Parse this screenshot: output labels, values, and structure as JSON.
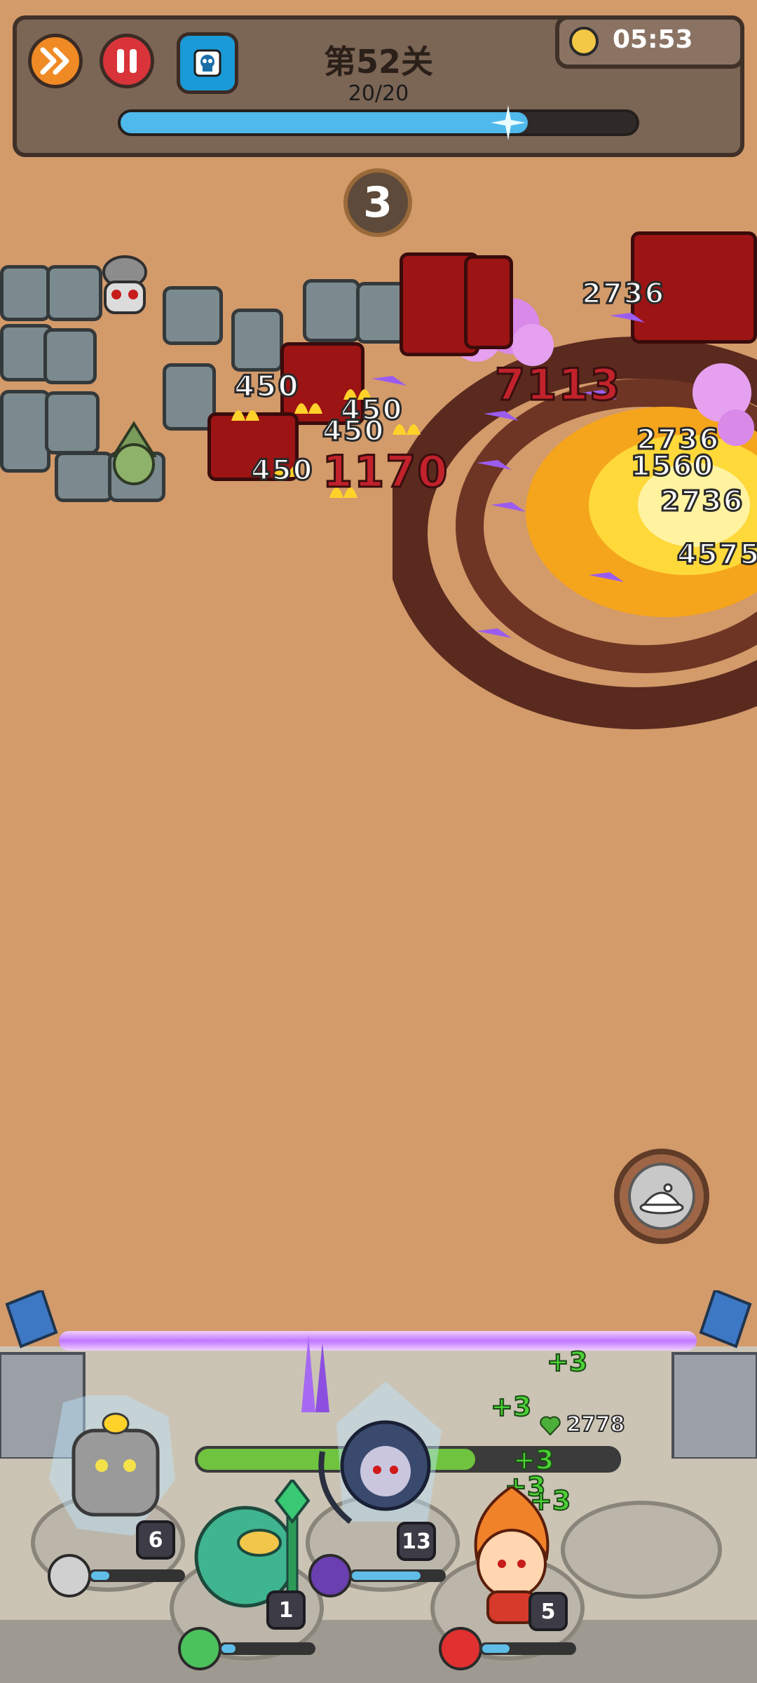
{
  "hud": {
    "level_title": "第52关",
    "wave_count": "20/20",
    "progress": 0.79,
    "timer": "05:53"
  },
  "countdown": "3",
  "damage_numbers": [
    "450",
    "450",
    "450",
    "450",
    "1170",
    "7113",
    "2736",
    "2736",
    "1560",
    "2736",
    "4575"
  ],
  "base": {
    "hp": "2778",
    "hp_fraction": 0.66,
    "heals": [
      "+3",
      "+3",
      "+3",
      "+3",
      "+3"
    ]
  },
  "heroes": [
    {
      "level": "6",
      "mana": 0.2
    },
    {
      "level": "1",
      "mana": 0.15
    },
    {
      "level": "13",
      "mana": 0.75
    },
    {
      "level": "5",
      "mana": 0.3
    }
  ],
  "colors": {
    "ground": "#d39a6a",
    "progress": "#4fb9ec",
    "hp": "#6fc33f",
    "damage_crit": "#c1222b",
    "heal": "#4bcf36"
  }
}
